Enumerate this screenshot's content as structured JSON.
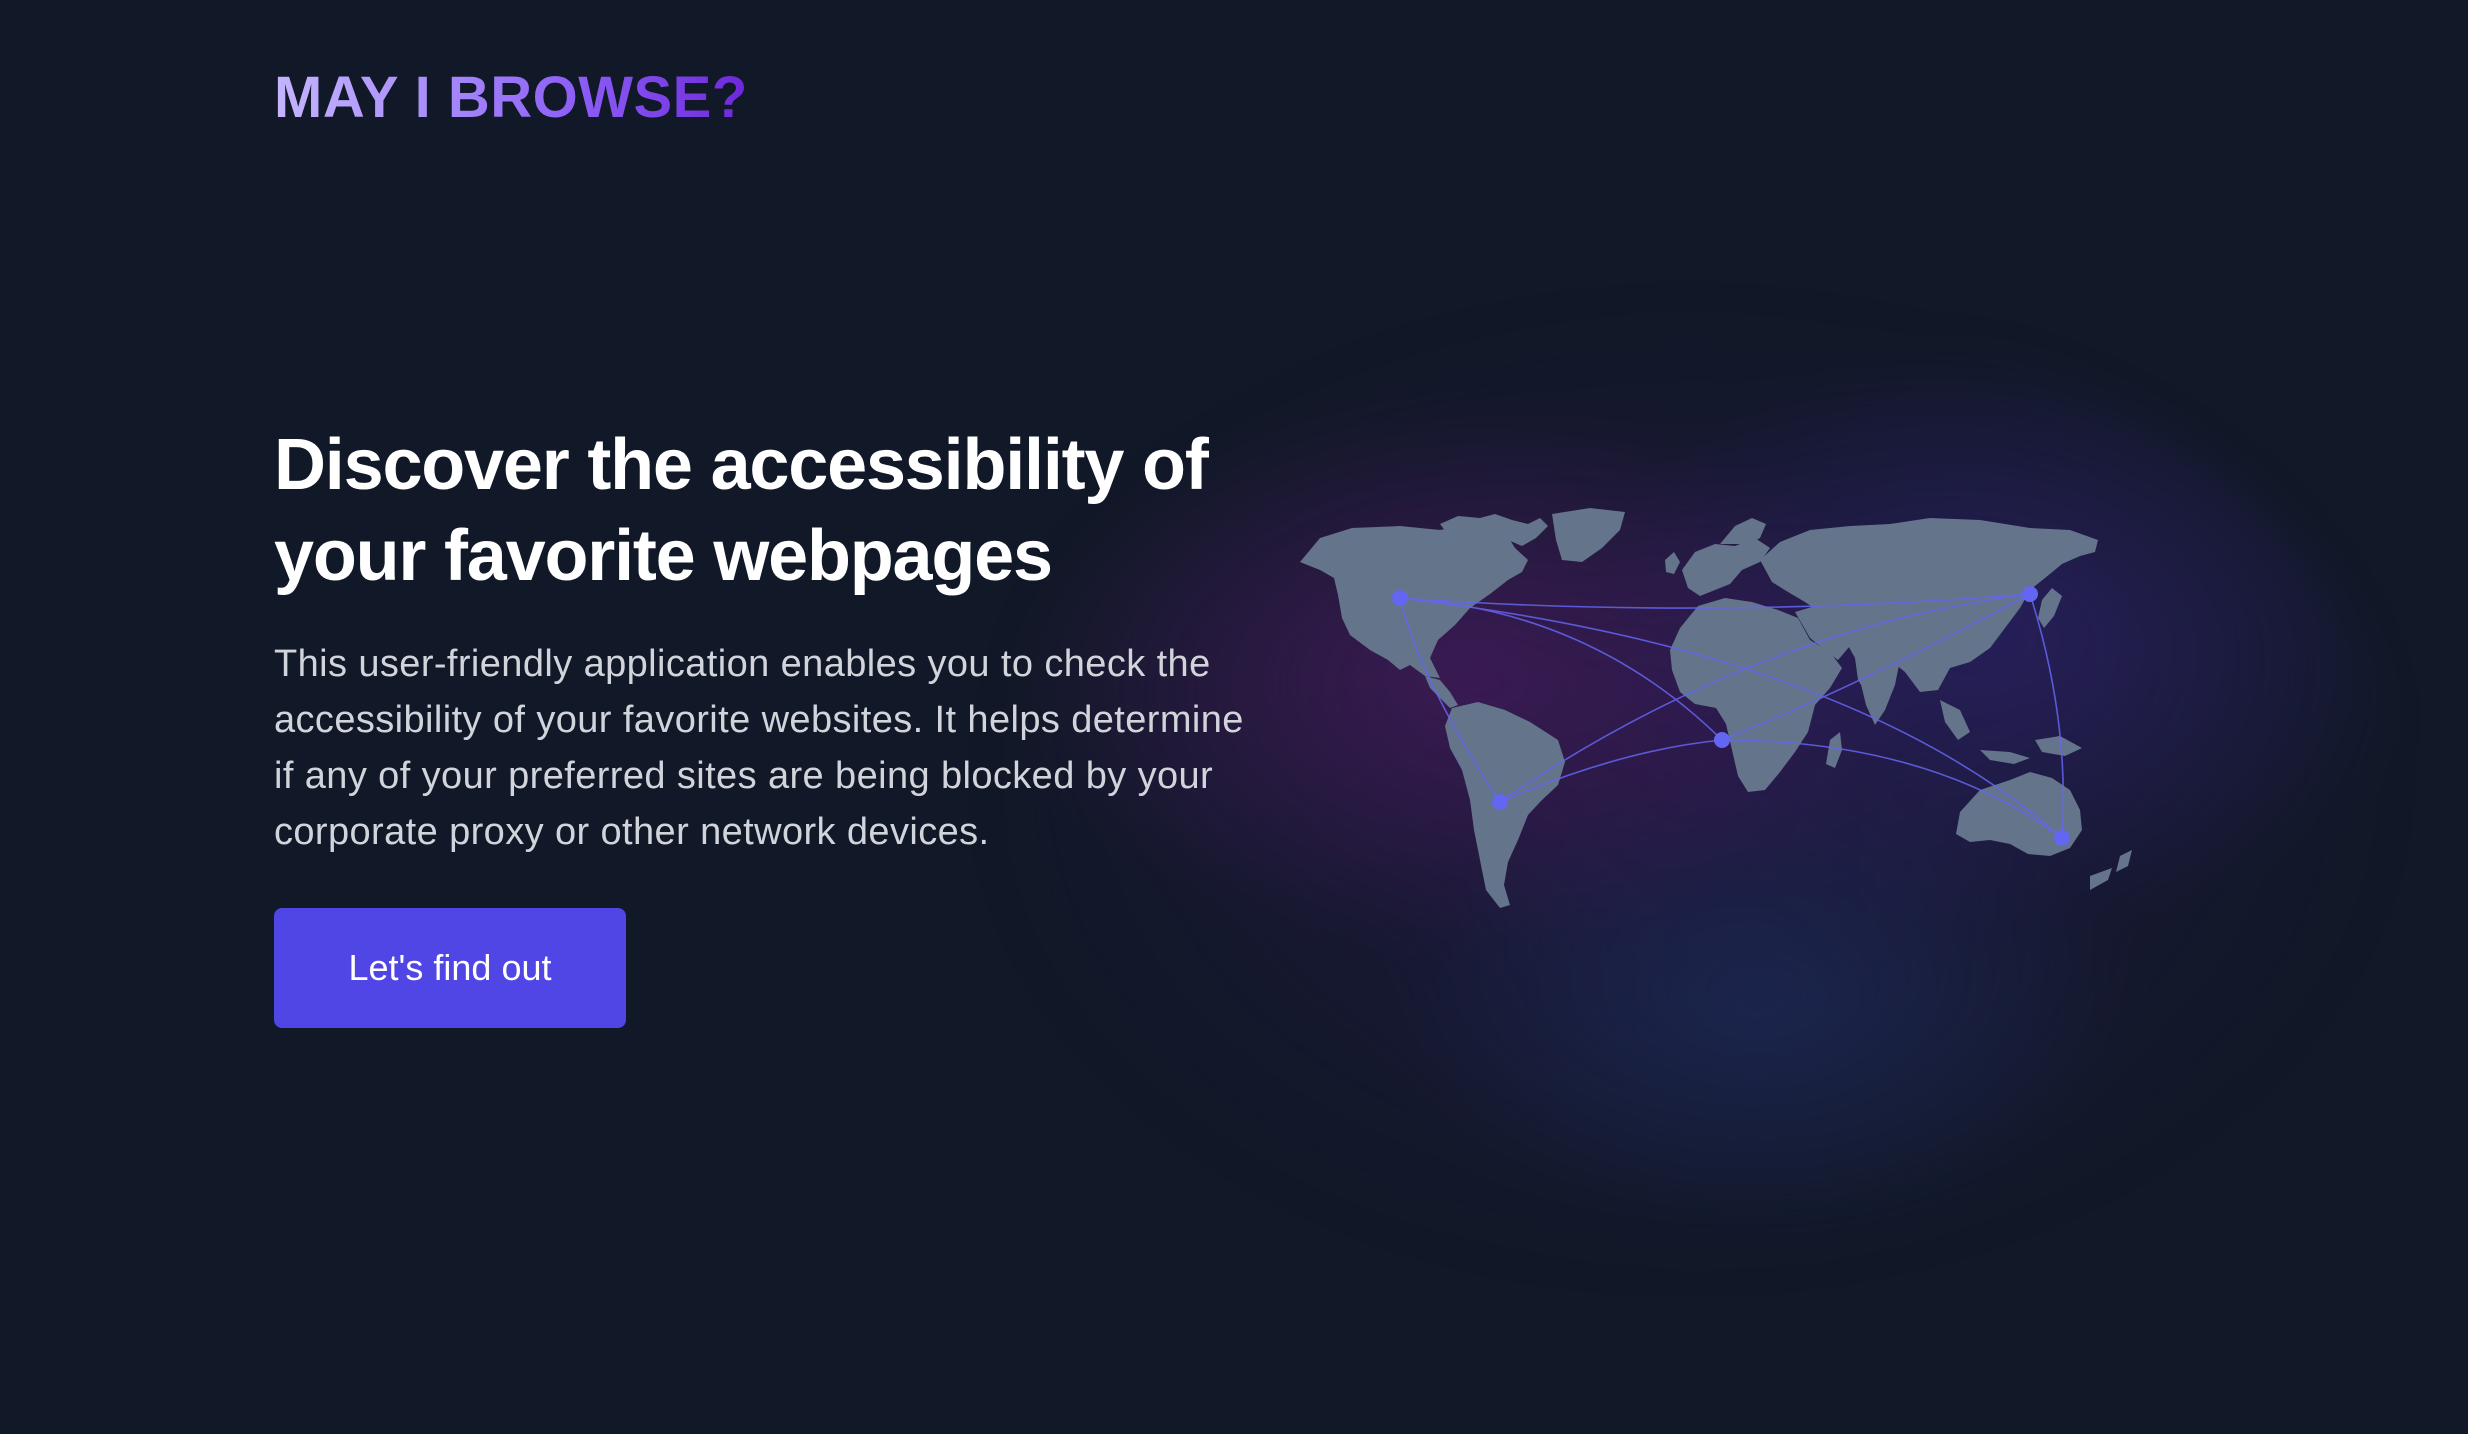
{
  "brand": {
    "logo_text": "MAY I BROWSE?"
  },
  "hero": {
    "headline": "Discover the accessibility of your favorite webpages",
    "description": "This user-friendly application enables you to check the accessibility of your favorite websites. It helps determine if any of your preferred sites are being blocked by your corporate proxy or other network devices.",
    "cta_label": "Let's find out"
  },
  "illustration": {
    "icon": "world-map-network-icon"
  },
  "colors": {
    "background": "#111827",
    "accent": "#4f46e5",
    "logo_gradient_start": "#c4b5fd",
    "logo_gradient_end": "#6d28d9",
    "map_land": "#64748b",
    "map_node": "#6366f1"
  }
}
